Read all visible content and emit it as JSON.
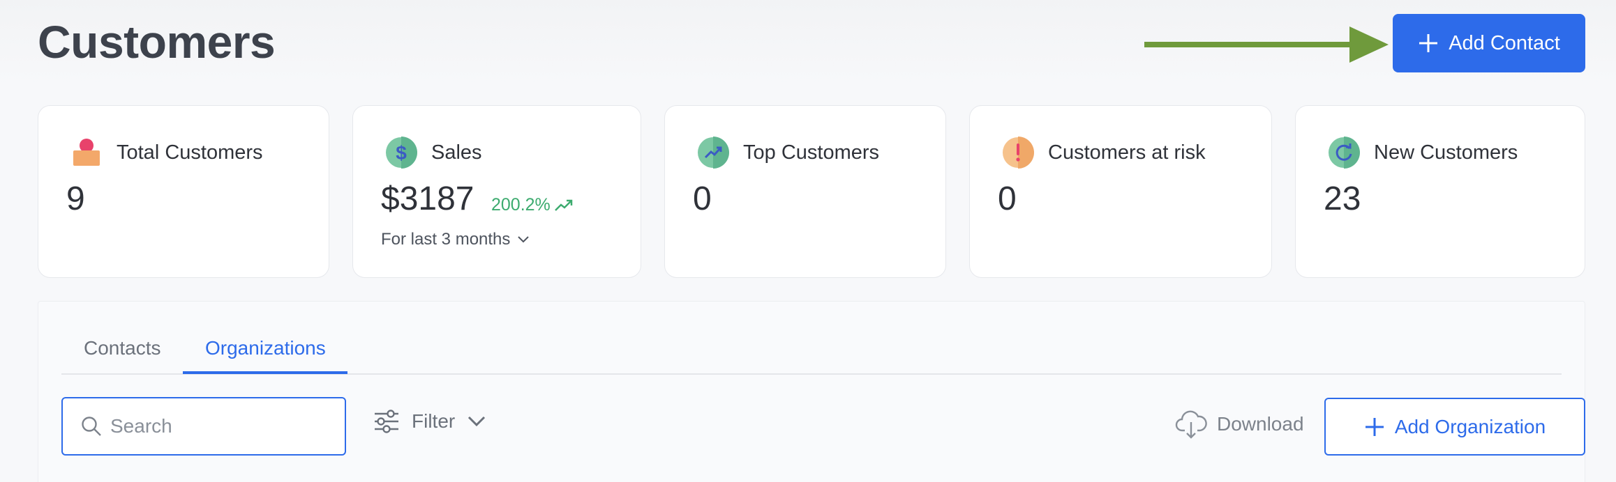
{
  "page": {
    "title": "Customers"
  },
  "header": {
    "add_contact_label": "Add Contact"
  },
  "stats": {
    "total_customers": {
      "label": "Total Customers",
      "value": "9"
    },
    "sales": {
      "label": "Sales",
      "value": "$3187",
      "growth": "200.2%",
      "period": "For last 3 months"
    },
    "top_customers": {
      "label": "Top Customers",
      "value": "0"
    },
    "at_risk": {
      "label": "Customers at risk",
      "value": "0"
    },
    "new_customers": {
      "label": "New Customers",
      "value": "23"
    }
  },
  "tabs": [
    {
      "label": "Contacts",
      "active": false
    },
    {
      "label": "Organizations",
      "active": true
    }
  ],
  "toolbar": {
    "search_placeholder": "Search",
    "filter_label": "Filter",
    "download_label": "Download",
    "add_organization_label": "Add Organization"
  },
  "colors": {
    "primary": "#2d6bea",
    "growth": "#3dab6f",
    "annotation_arrow": "#6f9a3c"
  },
  "icons": {
    "total_customers": "person-icon",
    "sales": "dollar-icon",
    "top_customers": "trend-up-icon",
    "at_risk": "alert-icon",
    "new_customers": "refresh-icon"
  }
}
